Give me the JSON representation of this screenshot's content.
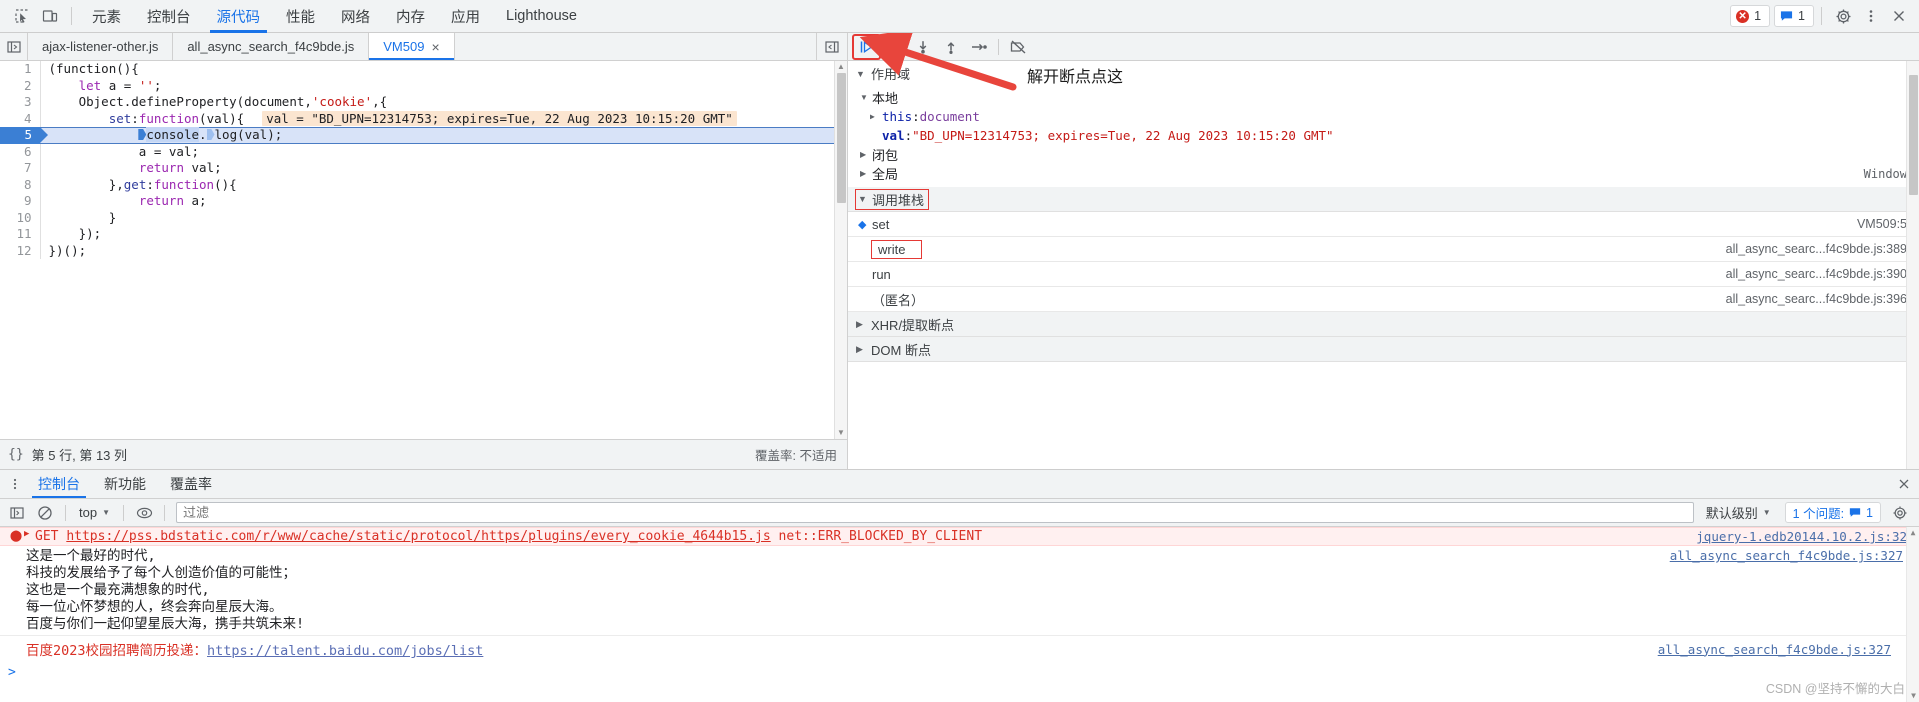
{
  "toolbar": {
    "inspect_icon": "inspect-element-icon",
    "device_icon": "device-toolbar-icon",
    "tabs": [
      {
        "label": "元素",
        "active": false
      },
      {
        "label": "控制台",
        "active": false
      },
      {
        "label": "源代码",
        "active": true
      },
      {
        "label": "性能",
        "active": false
      },
      {
        "label": "网络",
        "active": false
      },
      {
        "label": "内存",
        "active": false
      },
      {
        "label": "应用",
        "active": false
      },
      {
        "label": "Lighthouse",
        "active": false
      }
    ],
    "error_count": "1",
    "message_count": "1",
    "settings_icon": "gear-icon",
    "more_icon": "kebab-menu-icon",
    "close_icon": "close-icon"
  },
  "file_tabs": {
    "nav_icon": "show-navigator-icon",
    "tabs": [
      {
        "label": "ajax-listener-other.js",
        "active": false,
        "closable": false
      },
      {
        "label": "all_async_search_f4c9bde.js",
        "active": false,
        "closable": false
      },
      {
        "label": "VM509",
        "active": true,
        "closable": true
      }
    ],
    "close_glyph": "×",
    "right_icon": "show-debugger-sidebar-icon"
  },
  "editor": {
    "lines": [
      {
        "num": "1",
        "tokens": [
          {
            "t": "(function(){",
            "c": "plain"
          }
        ]
      },
      {
        "num": "2",
        "tokens": [
          {
            "t": "    ",
            "c": "plain"
          },
          {
            "t": "let",
            "c": "kw"
          },
          {
            "t": " a = ",
            "c": "plain"
          },
          {
            "t": "''",
            "c": "str"
          },
          {
            "t": ";",
            "c": "plain"
          }
        ]
      },
      {
        "num": "3",
        "tokens": [
          {
            "t": "    Object.defineProperty(document,",
            "c": "plain"
          },
          {
            "t": "'cookie'",
            "c": "str"
          },
          {
            "t": ",{",
            "c": "plain"
          }
        ]
      },
      {
        "num": "4",
        "tokens": [
          {
            "t": "        ",
            "c": "plain"
          },
          {
            "t": "set",
            "c": "prop"
          },
          {
            "t": ":",
            "c": "plain"
          },
          {
            "t": "function",
            "c": "kw"
          },
          {
            "t": "(val){",
            "c": "plain"
          }
        ],
        "inline_value": "val = \"BD_UPN=12314753; expires=Tue, 22 Aug 2023 10:15:20 GMT\""
      },
      {
        "num": "5",
        "current": true,
        "tokens": [
          {
            "t": "            ",
            "c": "plain"
          },
          {
            "t": "console",
            "c": "hl"
          },
          {
            "t": ".",
            "c": "plain"
          },
          {
            "t": "log(val);",
            "c": "plain"
          }
        ]
      },
      {
        "num": "6",
        "tokens": [
          {
            "t": "            a = val;",
            "c": "plain"
          }
        ]
      },
      {
        "num": "7",
        "tokens": [
          {
            "t": "            ",
            "c": "plain"
          },
          {
            "t": "return",
            "c": "kw"
          },
          {
            "t": " val;",
            "c": "plain"
          }
        ]
      },
      {
        "num": "8",
        "tokens": [
          {
            "t": "        },",
            "c": "plain"
          },
          {
            "t": "get",
            "c": "prop"
          },
          {
            "t": ":",
            "c": "plain"
          },
          {
            "t": "function",
            "c": "kw"
          },
          {
            "t": "(){",
            "c": "plain"
          }
        ]
      },
      {
        "num": "9",
        "tokens": [
          {
            "t": "            ",
            "c": "plain"
          },
          {
            "t": "return",
            "c": "kw"
          },
          {
            "t": " a;",
            "c": "plain"
          }
        ]
      },
      {
        "num": "10",
        "tokens": [
          {
            "t": "        }",
            "c": "plain"
          }
        ]
      },
      {
        "num": "11",
        "tokens": [
          {
            "t": "    });",
            "c": "plain"
          }
        ]
      },
      {
        "num": "12",
        "tokens": [
          {
            "t": "})();",
            "c": "plain"
          }
        ]
      }
    ]
  },
  "editor_status": {
    "format_icon": "{}",
    "cursor_position": "第 5 行, 第 13 列",
    "coverage": "覆盖率: 不适用"
  },
  "debugger_toolbar": {
    "buttons": [
      {
        "name": "resume-script-execution",
        "icon": "resume-icon",
        "highlighted": true
      },
      {
        "name": "step-over-next-function-call",
        "icon": "step-over-icon",
        "highlighted": false
      },
      {
        "name": "step-into-next-function-call",
        "icon": "step-into-icon",
        "highlighted": false
      },
      {
        "name": "step-out-of-current-function",
        "icon": "step-out-icon",
        "highlighted": false
      },
      {
        "name": "step",
        "icon": "step-icon",
        "highlighted": false
      },
      {
        "name": "deactivate-breakpoints",
        "icon": "deactivate-breakpoints-icon",
        "highlighted": false
      }
    ]
  },
  "annotation": {
    "text": "解开断点点这",
    "arrow_color": "#e8453c"
  },
  "scope": {
    "title": "作用域",
    "local_title": "本地",
    "rows": [
      {
        "tri": "▶",
        "key": "this",
        "sep": ": ",
        "value": "document",
        "value_type": "obj",
        "indent": 1
      },
      {
        "tri": "",
        "key": "val",
        "sep": ": ",
        "value": "\"BD_UPN=12314753; expires=Tue, 22 Aug 2023 10:15:20 GMT\"",
        "value_type": "str",
        "indent": 1,
        "bold_key": true
      }
    ],
    "closure_title": "闭包",
    "global_title": "全局",
    "global_value": "Window"
  },
  "call_stack": {
    "title": "调用堆栈",
    "title_boxed": true,
    "frames": [
      {
        "name": "set",
        "file": "VM509:5",
        "selected": true,
        "boxed": false
      },
      {
        "name": "write",
        "file": "all_async_searc...f4c9bde.js:389",
        "selected": false,
        "boxed": true
      },
      {
        "name": "run",
        "file": "all_async_searc...f4c9bde.js:390",
        "selected": false,
        "boxed": false
      },
      {
        "name": "（匿名）",
        "file": "all_async_searc...f4c9bde.js:396",
        "selected": false,
        "boxed": false
      }
    ]
  },
  "breakpoint_sections": [
    {
      "title": "XHR/提取断点"
    },
    {
      "title": "DOM 断点"
    }
  ],
  "drawer": {
    "kebab_icon": "kebab-menu-icon",
    "tabs": [
      {
        "label": "控制台",
        "active": true
      },
      {
        "label": "新功能",
        "active": false
      },
      {
        "label": "覆盖率",
        "active": false
      }
    ],
    "close_icon": "close-icon"
  },
  "console_toolbar": {
    "sidebar_icon": "show-console-sidebar-icon",
    "clear_icon": "clear-console-icon",
    "context": "top",
    "context_chevron": "▼",
    "eye_icon": "live-expression-icon",
    "filter_placeholder": "过滤",
    "filter_value": "",
    "level": "默认级别",
    "level_chevron": "▼",
    "issues_label": "1 个问题:",
    "issues_count": "1",
    "settings_icon": "gear-icon"
  },
  "console": {
    "error_row": {
      "icon": "error-icon",
      "tri": "▶",
      "method": "GET",
      "url": "https://pss.bdstatic.com/r/www/cache/static/protocol/https/plugins/every_cookie_4644b15.js",
      "status": "net::ERR_BLOCKED_BY_CLIENT",
      "source": "jquery-1.edb20144.10.2.js:32"
    },
    "poem": [
      "这是一个最好的时代,",
      "科技的发展给予了每个人创造价值的可能性；",
      "这也是一个最充满想象的时代,",
      "每一位心怀梦想的人，终会奔向星辰大海。",
      "百度与你们一起仰望星辰大海，携手共筑未来!"
    ],
    "poem_source": "all_async_search_f4c9bde.js:327",
    "recruit_label": "百度2023校园招聘简历投递：",
    "recruit_url": "https://talent.baidu.com/jobs/list",
    "recruit_source": "all_async_search_f4c9bde.js:327",
    "prompt": ">"
  },
  "watermark": "CSDN @坚持不懈的大白"
}
